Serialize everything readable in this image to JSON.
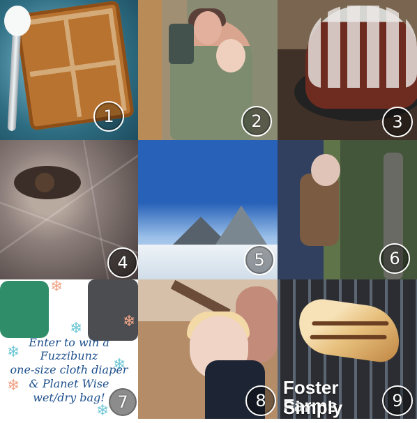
{
  "tiles": [
    {
      "badge": "1"
    },
    {
      "badge": "2"
    },
    {
      "badge": "3"
    },
    {
      "badge": "4"
    },
    {
      "badge": "5"
    },
    {
      "badge": "6"
    },
    {
      "badge": "7",
      "promo_lines": [
        "Enter to win a",
        "Fuzzibunz",
        "one-size cloth diaper",
        "& Planet Wise",
        "wet/dry bag!"
      ]
    },
    {
      "badge": "8"
    },
    {
      "badge": "9",
      "brand_lines": [
        "Foster Farms",
        "Simply Raised"
      ]
    }
  ]
}
